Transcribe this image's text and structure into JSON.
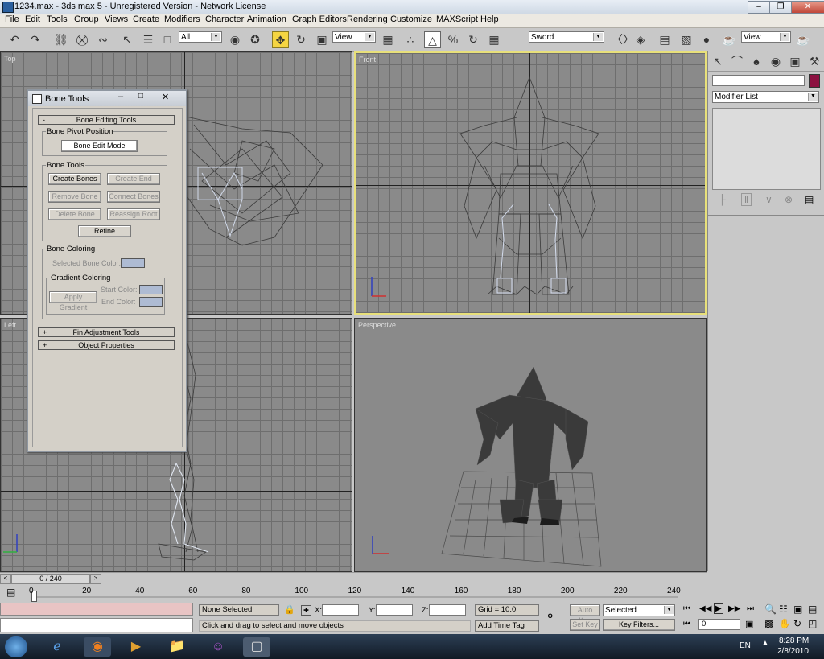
{
  "titlebar": {
    "title": "1234.max - 3ds max 5 - Unregistered Version - Network License"
  },
  "menu": [
    "File",
    "Edit",
    "Tools",
    "Group",
    "Views",
    "Create",
    "Modifiers",
    "Character",
    "Animation",
    "Graph Editors",
    "Rendering",
    "Customize",
    "MAXScript",
    "Help"
  ],
  "toolbar": {
    "selection_filter": "All",
    "ref_coord": "View",
    "named_selection": "Sword",
    "render_view": "View"
  },
  "viewports": {
    "top": "Top",
    "front": "Front",
    "left": "Left",
    "perspective": "Perspective"
  },
  "bone_tools": {
    "window_title": "Bone Tools",
    "rollout_editing": "Bone Editing Tools",
    "pivot_group": "Bone Pivot Position",
    "bone_edit_mode": "Bone Edit Mode",
    "tools_group": "Bone Tools",
    "create_bones": "Create Bones",
    "create_end": "Create End",
    "remove_bone": "Remove Bone",
    "connect_bones": "Connect Bones",
    "delete_bone": "Delete Bone",
    "reassign_root": "Reassign Root",
    "refine": "Refine",
    "coloring_group": "Bone Coloring",
    "selected_bone_color": "Selected Bone Color:",
    "gradient_group": "Gradient Coloring",
    "apply_gradient": "Apply Gradient",
    "start_color": "Start Color:",
    "end_color": "End Color:",
    "rollout_fin": "Fin Adjustment Tools",
    "rollout_object": "Object Properties",
    "collapse_sign": "-",
    "expand_sign": "+"
  },
  "command_panel": {
    "modifier_list": "Modifier List",
    "object_color": "#8c1040"
  },
  "timeline": {
    "frame": "0 / 240",
    "ticks": [
      "0",
      "20",
      "40",
      "60",
      "80",
      "100",
      "120",
      "140",
      "160",
      "180",
      "200",
      "220",
      "240"
    ]
  },
  "status": {
    "selection": "None Selected",
    "prompt": "Click and drag to select and move objects",
    "x_label": "X:",
    "y_label": "Y:",
    "z_label": "Z:",
    "grid": "Grid = 10.0",
    "add_time_tag": "Add Time Tag",
    "auto_key": "Auto Key",
    "set_key": "Set Key",
    "key_mode": "Selected",
    "key_filters": "Key Filters...",
    "current_frame": "0"
  },
  "taskbar": {
    "time": "8:28 PM",
    "date": "2/8/2010",
    "lang": "EN"
  }
}
